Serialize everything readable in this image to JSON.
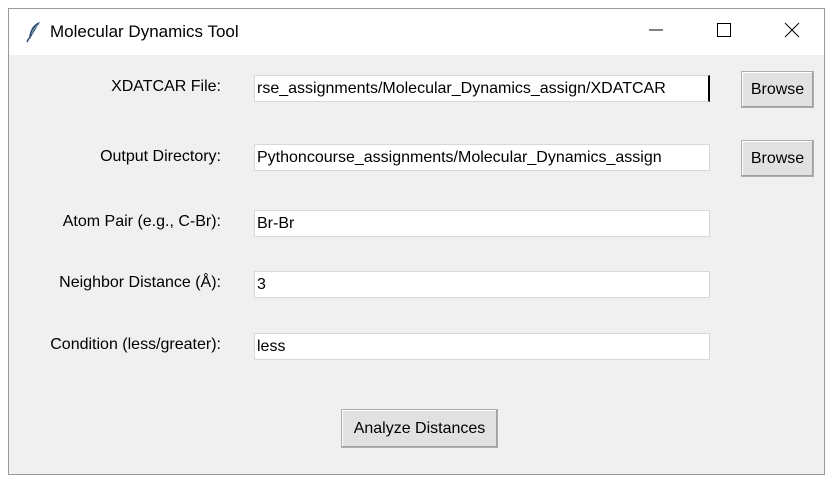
{
  "window": {
    "title": "Molecular Dynamics Tool"
  },
  "form": {
    "xdatcar": {
      "label": "XDATCAR File:",
      "value": "rse_assignments/Molecular_Dynamics_assign/XDATCAR",
      "button_label": "Browse"
    },
    "output_dir": {
      "label": "Output Directory:",
      "value": "Pythoncourse_assignments/Molecular_Dynamics_assign",
      "button_label": "Browse"
    },
    "atom_pair": {
      "label": "Atom Pair (e.g., C-Br):",
      "value": "Br-Br"
    },
    "neighbor_distance": {
      "label": "Neighbor Distance (Å):",
      "value": "3"
    },
    "condition": {
      "label": "Condition (less/greater):",
      "value": "less"
    }
  },
  "actions": {
    "analyze_label": "Analyze Distances"
  },
  "icons": {
    "app": "feather-icon",
    "minimize": "minimize-icon",
    "maximize": "maximize-icon",
    "close": "close-icon"
  }
}
